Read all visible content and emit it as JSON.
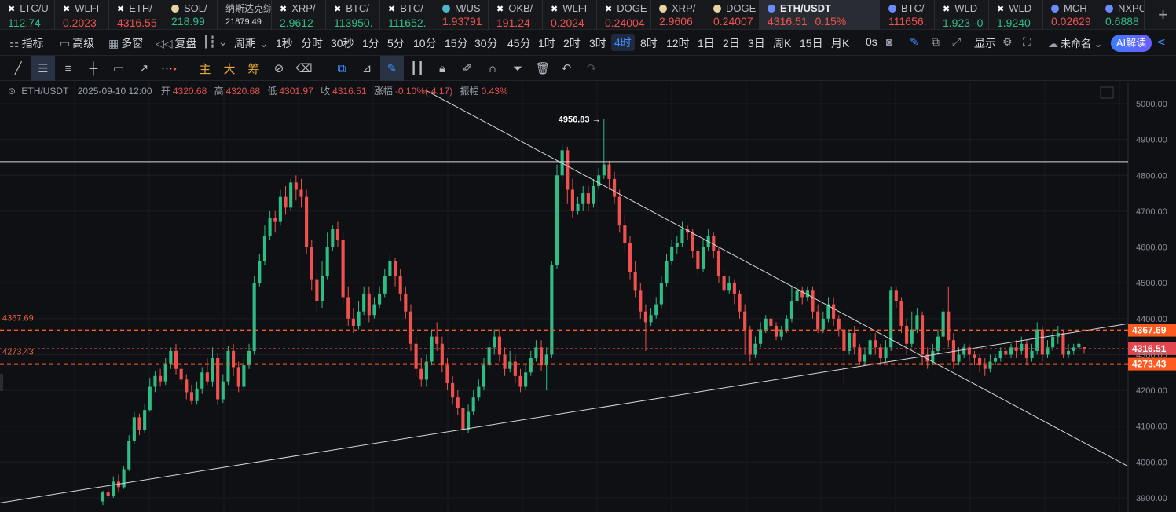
{
  "tickers": [
    {
      "symbol": "LTC/U",
      "price": "112.74",
      "dir": "up",
      "marker": "✖",
      "markerColor": "#ffffff"
    },
    {
      "symbol": "WLFI",
      "price": "0.2023",
      "dir": "dn",
      "marker": "✖",
      "markerColor": "#ffffff"
    },
    {
      "symbol": "ETH/",
      "price": "4316.55",
      "dir": "dn",
      "marker": "✖",
      "markerColor": "#ffffff"
    },
    {
      "symbol": "SOL/",
      "price": "218.99",
      "dir": "up",
      "marker": "●",
      "markerColor": "#e6d3a3"
    },
    {
      "symbol": "纳斯达克综",
      "price": "21879.49",
      "dir": "neutral",
      "marker": "",
      "markerColor": ""
    },
    {
      "symbol": "XRP/",
      "price": "2.9612",
      "dir": "up",
      "marker": "✖",
      "markerColor": "#ffffff"
    },
    {
      "symbol": "BTC/",
      "price": "113950.",
      "dir": "up",
      "marker": "✖",
      "markerColor": "#ffffff"
    },
    {
      "symbol": "BTC/",
      "price": "111652.",
      "dir": "up",
      "marker": "✖",
      "markerColor": "#ffffff"
    },
    {
      "symbol": "M/US",
      "price": "1.93791",
      "dir": "dn",
      "marker": "●",
      "markerColor": "#4db6c9"
    },
    {
      "symbol": "OKB/",
      "price": "191.24",
      "dir": "dn",
      "marker": "✖",
      "markerColor": "#ffffff"
    },
    {
      "symbol": "WLFI",
      "price": "0.2024",
      "dir": "dn",
      "marker": "✖",
      "markerColor": "#ffffff"
    },
    {
      "symbol": "DOGE",
      "price": "0.24004",
      "dir": "dn",
      "marker": "✖",
      "markerColor": "#ffffff"
    },
    {
      "symbol": "XRP/",
      "price": "2.9606",
      "dir": "dn",
      "marker": "●",
      "markerColor": "#e6d3a3"
    },
    {
      "symbol": "DOGE",
      "price": "0.24007",
      "dir": "dn",
      "marker": "●",
      "markerColor": "#e6d3a3"
    },
    {
      "symbol": "ETH/USDT",
      "price": "4316.51",
      "change": "0.15%",
      "dir": "dn",
      "marker": "●",
      "markerColor": "#6b8cff",
      "active": true
    },
    {
      "symbol": "BTC/",
      "price": "111656.",
      "dir": "dn",
      "marker": "●",
      "markerColor": "#6b8cff"
    },
    {
      "symbol": "WLD",
      "price": "1.923 -0",
      "dir": "up",
      "marker": "✖",
      "markerColor": "#ffffff"
    },
    {
      "symbol": "WLD",
      "price": "1.9240",
      "dir": "up",
      "marker": "✖",
      "markerColor": "#ffffff"
    },
    {
      "symbol": "MCH",
      "price": "0.02629",
      "dir": "dn",
      "marker": "●",
      "markerColor": "#6b8cff"
    },
    {
      "symbol": "NXPC",
      "price": "0.6888",
      "dir": "up",
      "marker": "●",
      "markerColor": "#6b8cff"
    }
  ],
  "add_tab": "+",
  "period_bar": {
    "indicator": "指标",
    "advanced": "高级",
    "multi_window": "多窗",
    "replay": "复盘",
    "period": "周期",
    "periods": [
      "1秒",
      "分时",
      "30秒",
      "1分",
      "5分",
      "10分",
      "15分",
      "30分",
      "45分",
      "1时",
      "2时",
      "3时",
      "4时",
      "8时",
      "12时",
      "1日",
      "2日",
      "3日",
      "周K",
      "15日",
      "月K"
    ],
    "selected_period": "4时",
    "countdown": "0s",
    "display": "显示",
    "unnamed": "未命名",
    "ai": "AI解读"
  },
  "draw_tools": {
    "main": "主",
    "big": "大",
    "chips": "筹"
  },
  "legend": {
    "pair": "ETH/USDT",
    "datetime": "2025-09-10 12:00",
    "open_label": "开",
    "open": "4320.68",
    "high_label": "高",
    "high": "4320.68",
    "low_label": "低",
    "low": "4301.97",
    "close_label": "收",
    "close": "4316.51",
    "change_label": "涨幅",
    "change": "-0.10%(-4.17)",
    "amplitude_label": "振幅",
    "amplitude": "0.43%"
  },
  "colors": {
    "up": "#2ebd85",
    "down": "#f0514e",
    "level": "#ff5a1f",
    "trendline": "#d6d8dc",
    "background": "#0f1014"
  },
  "chart_data": {
    "type": "candlestick",
    "symbol": "ETH/USDT",
    "interval": "4时",
    "y_ticks": [
      "5000.00",
      "4900.00",
      "4800.00",
      "4700.00",
      "4600.00",
      "4500.00",
      "4400.00",
      "4300.00",
      "4200.00",
      "4100.00",
      "4000.00",
      "3900.00"
    ],
    "ylim": [
      3888,
      5038
    ],
    "peak_label": "4956.83",
    "levels": [
      {
        "value": 4367.69,
        "label": "4367.69",
        "style": "dashed"
      },
      {
        "value": 4273.43,
        "label": "4273.43",
        "style": "dashed"
      }
    ],
    "last_price": {
      "value": 4316.51,
      "label": "4316.51"
    },
    "trendlines": [
      {
        "from": [
          0.0,
          4838.0
        ],
        "to": [
          1.0,
          4838.0
        ]
      },
      {
        "from": [
          0.0,
          3886.0
        ],
        "to": [
          1.0,
          4386.0
        ]
      },
      {
        "from": [
          0.377,
          5038.0
        ],
        "to": [
          1.0,
          3988.0
        ]
      }
    ],
    "candles": [
      [
        3890,
        3915,
        3880,
        3920
      ],
      [
        3915,
        3905,
        3895,
        3935
      ],
      [
        3905,
        3945,
        3900,
        3960
      ],
      [
        3945,
        3930,
        3915,
        3965
      ],
      [
        3930,
        3980,
        3925,
        3990
      ],
      [
        3980,
        4060,
        3975,
        4075
      ],
      [
        4060,
        4125,
        4050,
        4140
      ],
      [
        4125,
        4090,
        4075,
        4135
      ],
      [
        4090,
        4145,
        4080,
        4160
      ],
      [
        4145,
        4210,
        4140,
        4235
      ],
      [
        4210,
        4240,
        4195,
        4255
      ],
      [
        4240,
        4225,
        4210,
        4260
      ],
      [
        4225,
        4275,
        4215,
        4290
      ],
      [
        4275,
        4310,
        4260,
        4320
      ],
      [
        4310,
        4260,
        4245,
        4330
      ],
      [
        4260,
        4230,
        4215,
        4275
      ],
      [
        4230,
        4195,
        4175,
        4245
      ],
      [
        4195,
        4170,
        4160,
        4215
      ],
      [
        4170,
        4205,
        4160,
        4225
      ],
      [
        4205,
        4250,
        4190,
        4265
      ],
      [
        4250,
        4225,
        4215,
        4290
      ],
      [
        4225,
        4290,
        4210,
        4320
      ],
      [
        4290,
        4175,
        4160,
        4305
      ],
      [
        4175,
        4225,
        4165,
        4245
      ],
      [
        4225,
        4310,
        4215,
        4325
      ],
      [
        4310,
        4265,
        4240,
        4330
      ],
      [
        4265,
        4210,
        4195,
        4280
      ],
      [
        4210,
        4270,
        4200,
        4295
      ],
      [
        4270,
        4310,
        4260,
        4330
      ],
      [
        4310,
        4500,
        4300,
        4520
      ],
      [
        4500,
        4560,
        4490,
        4580
      ],
      [
        4560,
        4630,
        4550,
        4660
      ],
      [
        4630,
        4680,
        4620,
        4700
      ],
      [
        4680,
        4670,
        4640,
        4700
      ],
      [
        4670,
        4740,
        4660,
        4760
      ],
      [
        4740,
        4710,
        4690,
        4770
      ],
      [
        4710,
        4780,
        4700,
        4790
      ],
      [
        4780,
        4760,
        4730,
        4800
      ],
      [
        4760,
        4740,
        4710,
        4790
      ],
      [
        4740,
        4600,
        4580,
        4760
      ],
      [
        4600,
        4510,
        4480,
        4620
      ],
      [
        4510,
        4450,
        4420,
        4530
      ],
      [
        4450,
        4520,
        4430,
        4560
      ],
      [
        4520,
        4600,
        4510,
        4640
      ],
      [
        4600,
        4650,
        4590,
        4660
      ],
      [
        4650,
        4620,
        4600,
        4670
      ],
      [
        4620,
        4460,
        4440,
        4640
      ],
      [
        4460,
        4400,
        4380,
        4490
      ],
      [
        4400,
        4380,
        4360,
        4430
      ],
      [
        4380,
        4420,
        4370,
        4450
      ],
      [
        4420,
        4470,
        4410,
        4490
      ],
      [
        4470,
        4410,
        4390,
        4490
      ],
      [
        4410,
        4440,
        4400,
        4460
      ],
      [
        4440,
        4470,
        4430,
        4490
      ],
      [
        4470,
        4520,
        4460,
        4540
      ],
      [
        4520,
        4560,
        4510,
        4580
      ],
      [
        4560,
        4520,
        4490,
        4570
      ],
      [
        4520,
        4470,
        4450,
        4540
      ],
      [
        4470,
        4420,
        4400,
        4490
      ],
      [
        4420,
        4330,
        4310,
        4440
      ],
      [
        4330,
        4260,
        4240,
        4350
      ],
      [
        4260,
        4230,
        4210,
        4290
      ],
      [
        4230,
        4280,
        4210,
        4300
      ],
      [
        4280,
        4350,
        4270,
        4370
      ],
      [
        4350,
        4330,
        4310,
        4390
      ],
      [
        4330,
        4270,
        4250,
        4350
      ],
      [
        4270,
        4220,
        4200,
        4290
      ],
      [
        4220,
        4180,
        4160,
        4240
      ],
      [
        4180,
        4150,
        4130,
        4200
      ],
      [
        4150,
        4090,
        4070,
        4165
      ],
      [
        4090,
        4140,
        4080,
        4160
      ],
      [
        4140,
        4180,
        4130,
        4200
      ],
      [
        4180,
        4210,
        4170,
        4230
      ],
      [
        4210,
        4270,
        4200,
        4290
      ],
      [
        4270,
        4320,
        4260,
        4340
      ],
      [
        4320,
        4350,
        4300,
        4370
      ],
      [
        4350,
        4300,
        4280,
        4370
      ],
      [
        4300,
        4260,
        4240,
        4320
      ],
      [
        4260,
        4280,
        4250,
        4310
      ],
      [
        4280,
        4240,
        4220,
        4300
      ],
      [
        4240,
        4210,
        4195,
        4260
      ],
      [
        4210,
        4250,
        4200,
        4270
      ],
      [
        4250,
        4290,
        4240,
        4310
      ],
      [
        4290,
        4320,
        4280,
        4340
      ],
      [
        4320,
        4270,
        4255,
        4340
      ],
      [
        4270,
        4300,
        4200,
        4320
      ],
      [
        4300,
        4550,
        4290,
        4560
      ],
      [
        4550,
        4800,
        4540,
        4830
      ],
      [
        4800,
        4870,
        4780,
        4890
      ],
      [
        4870,
        4760,
        4720,
        4880
      ],
      [
        4760,
        4700,
        4680,
        4790
      ],
      [
        4700,
        4720,
        4690,
        4740
      ],
      [
        4720,
        4750,
        4700,
        4770
      ],
      [
        4750,
        4720,
        4700,
        4770
      ],
      [
        4720,
        4770,
        4710,
        4790
      ],
      [
        4770,
        4800,
        4760,
        4820
      ],
      [
        4800,
        4830,
        4790,
        4956.83
      ],
      [
        4830,
        4790,
        4760,
        4840
      ],
      [
        4790,
        4740,
        4720,
        4810
      ],
      [
        4740,
        4660,
        4640,
        4760
      ],
      [
        4660,
        4610,
        4590,
        4690
      ],
      [
        4610,
        4530,
        4510,
        4630
      ],
      [
        4530,
        4480,
        4460,
        4560
      ],
      [
        4480,
        4420,
        4400,
        4500
      ],
      [
        4420,
        4390,
        4310,
        4440
      ],
      [
        4390,
        4410,
        4380,
        4430
      ],
      [
        4410,
        4440,
        4400,
        4460
      ],
      [
        4440,
        4500,
        4430,
        4520
      ],
      [
        4500,
        4560,
        4490,
        4580
      ],
      [
        4560,
        4600,
        4550,
        4620
      ],
      [
        4600,
        4610,
        4580,
        4630
      ],
      [
        4610,
        4650,
        4600,
        4670
      ],
      [
        4650,
        4640,
        4620,
        4660
      ],
      [
        4640,
        4590,
        4570,
        4650
      ],
      [
        4590,
        4540,
        4520,
        4600
      ],
      [
        4540,
        4600,
        4530,
        4620
      ],
      [
        4600,
        4630,
        4590,
        4650
      ],
      [
        4630,
        4590,
        4570,
        4640
      ],
      [
        4590,
        4520,
        4500,
        4600
      ],
      [
        4520,
        4480,
        4470,
        4540
      ],
      [
        4480,
        4500,
        4470,
        4520
      ],
      [
        4500,
        4470,
        4440,
        4510
      ],
      [
        4470,
        4420,
        4400,
        4480
      ],
      [
        4420,
        4370,
        4300,
        4440
      ],
      [
        4370,
        4300,
        4280,
        4380
      ],
      [
        4300,
        4330,
        4290,
        4350
      ],
      [
        4330,
        4370,
        4320,
        4390
      ],
      [
        4370,
        4400,
        4360,
        4410
      ],
      [
        4400,
        4380,
        4360,
        4410
      ],
      [
        4380,
        4350,
        4340,
        4390
      ],
      [
        4350,
        4370,
        4340,
        4380
      ],
      [
        4370,
        4400,
        4360,
        4410
      ],
      [
        4400,
        4450,
        4390,
        4490
      ],
      [
        4450,
        4480,
        4440,
        4500
      ],
      [
        4480,
        4460,
        4440,
        4490
      ],
      [
        4460,
        4480,
        4450,
        4490
      ],
      [
        4480,
        4420,
        4400,
        4490
      ],
      [
        4420,
        4370,
        4360,
        4440
      ],
      [
        4370,
        4400,
        4360,
        4420
      ],
      [
        4400,
        4440,
        4390,
        4460
      ],
      [
        4440,
        4400,
        4380,
        4460
      ],
      [
        4400,
        4370,
        4350,
        4410
      ],
      [
        4370,
        4310,
        4220,
        4380
      ],
      [
        4310,
        4360,
        4300,
        4370
      ],
      [
        4360,
        4320,
        4300,
        4380
      ],
      [
        4320,
        4280,
        4270,
        4330
      ],
      [
        4280,
        4300,
        4270,
        4320
      ],
      [
        4300,
        4340,
        4290,
        4360
      ],
      [
        4340,
        4320,
        4300,
        4360
      ],
      [
        4320,
        4290,
        4270,
        4330
      ],
      [
        4290,
        4320,
        4280,
        4340
      ],
      [
        4320,
        4480,
        4310,
        4490
      ],
      [
        4480,
        4450,
        4430,
        4490
      ],
      [
        4450,
        4380,
        4360,
        4460
      ],
      [
        4380,
        4330,
        4300,
        4400
      ],
      [
        4330,
        4370,
        4320,
        4420
      ],
      [
        4370,
        4410,
        4360,
        4430
      ],
      [
        4410,
        4300,
        4270,
        4420
      ],
      [
        4300,
        4280,
        4260,
        4320
      ],
      [
        4280,
        4310,
        4270,
        4330
      ],
      [
        4310,
        4350,
        4300,
        4370
      ],
      [
        4350,
        4420,
        4340,
        4430
      ],
      [
        4420,
        4340,
        4320,
        4490
      ],
      [
        4340,
        4280,
        4260,
        4360
      ],
      [
        4280,
        4300,
        4270,
        4320
      ],
      [
        4300,
        4320,
        4290,
        4330
      ],
      [
        4320,
        4300,
        4280,
        4330
      ],
      [
        4300,
        4290,
        4270,
        4310
      ],
      [
        4290,
        4270,
        4250,
        4300
      ],
      [
        4270,
        4260,
        4240,
        4290
      ],
      [
        4260,
        4280,
        4250,
        4300
      ],
      [
        4280,
        4290,
        4270,
        4300
      ],
      [
        4290,
        4310,
        4280,
        4320
      ],
      [
        4310,
        4300,
        4290,
        4320
      ],
      [
        4300,
        4320,
        4290,
        4330
      ],
      [
        4320,
        4310,
        4290,
        4340
      ],
      [
        4310,
        4330,
        4300,
        4350
      ],
      [
        4330,
        4290,
        4270,
        4340
      ],
      [
        4290,
        4310,
        4280,
        4330
      ],
      [
        4310,
        4370,
        4300,
        4390
      ],
      [
        4370,
        4300,
        4280,
        4380
      ],
      [
        4300,
        4320,
        4290,
        4340
      ],
      [
        4320,
        4350,
        4310,
        4370
      ],
      [
        4350,
        4360,
        4330,
        4380
      ],
      [
        4360,
        4300,
        4290,
        4370
      ],
      [
        4300,
        4310,
        4290,
        4330
      ],
      [
        4310,
        4320,
        4300,
        4330
      ],
      [
        4320,
        4330,
        4310,
        4340
      ],
      [
        4320.68,
        4316.51,
        4301.97,
        4320.68
      ]
    ]
  }
}
